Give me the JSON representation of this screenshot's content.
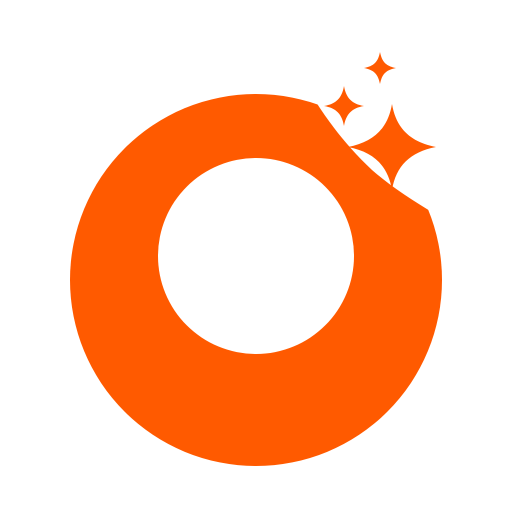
{
  "logo": {
    "shape": "bitten-ring",
    "ring_color": "#ff5a00",
    "hole_color": "#ffffff",
    "background_color": "#ffffff",
    "sparkle_count": 3,
    "sparkle_color": "#ff5a00"
  }
}
